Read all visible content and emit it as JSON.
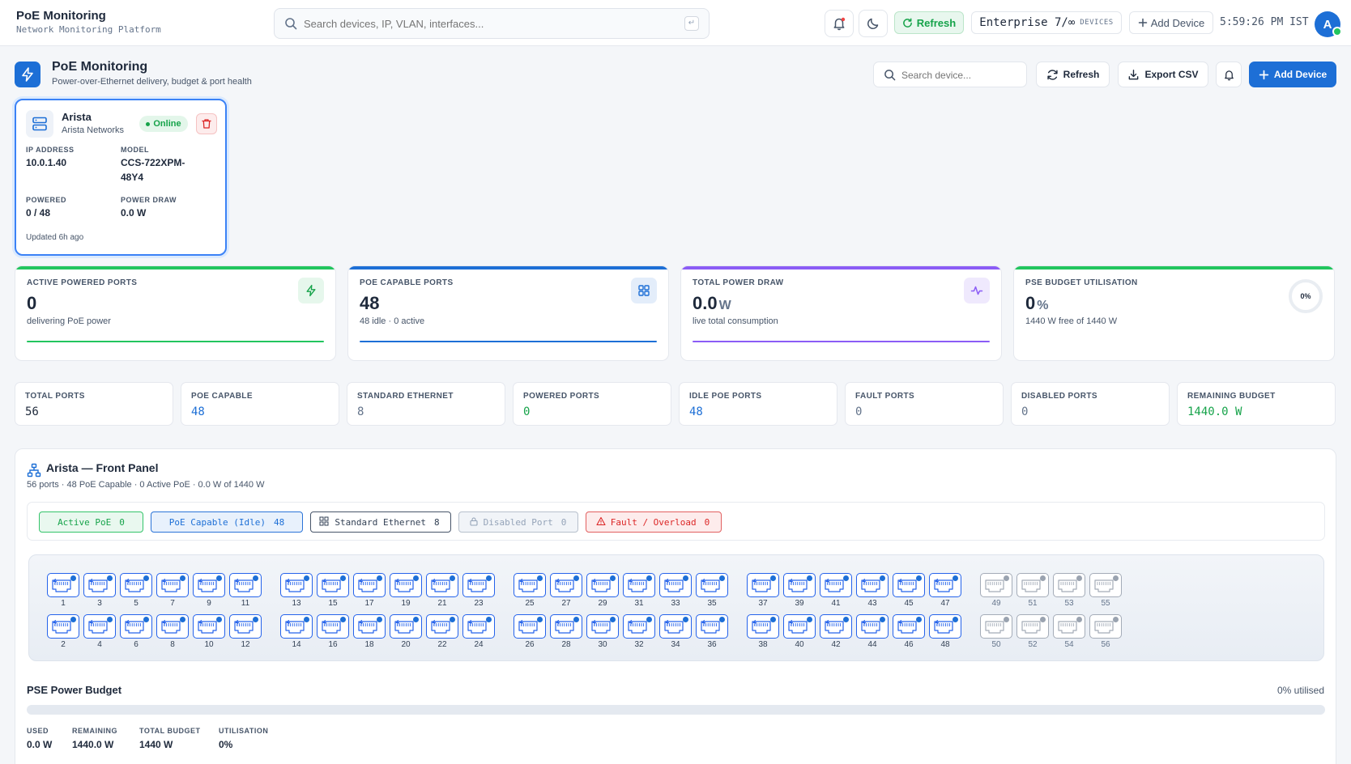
{
  "app": {
    "title": "PoE Monitoring",
    "subtitle": "Network Monitoring Platform"
  },
  "topbar": {
    "search_placeholder": "Search devices, IP, VLAN, interfaces...",
    "search_kbd": "↵",
    "refresh_label": "Refresh",
    "plan_name": "Enterprise 7/∞",
    "plan_suffix": "DEVICES",
    "add_device_label": "Add Device",
    "clock": "5:59:26 PM IST",
    "avatar_initial": "A"
  },
  "header": {
    "title": "PoE Monitoring",
    "subtitle": "Power-over-Ethernet delivery, budget & port health",
    "search_placeholder": "Search device...",
    "refresh_label": "Refresh",
    "export_label": "Export CSV",
    "add_device_label": "Add Device"
  },
  "device": {
    "name": "Arista",
    "vendor": "Arista Networks",
    "status": "Online",
    "ip_label": "IP ADDRESS",
    "ip": "10.0.1.40",
    "model_label": "MODEL",
    "model_line1": "CCS-722XPM-",
    "model_line2": "48Y4",
    "powered_label": "POWERED",
    "powered": "0 / 48",
    "draw_label": "POWER DRAW",
    "draw": "0.0 W",
    "updated": "Updated 6h ago"
  },
  "stats": [
    {
      "label": "ACTIVE POWERED PORTS",
      "value": "0",
      "unit": "",
      "sub": "delivering PoE power",
      "color": "#22c55e",
      "icon": "bolt-icon"
    },
    {
      "label": "POE CAPABLE PORTS",
      "value": "48",
      "unit": "",
      "sub": "48 idle · 0 active",
      "color": "#1d6fd6",
      "icon": "grid-icon"
    },
    {
      "label": "TOTAL POWER DRAW",
      "value": "0.0",
      "unit": "W",
      "sub": "live total consumption",
      "color": "#8b5cf6",
      "icon": "activity-icon"
    },
    {
      "label": "PSE BUDGET UTILISATION",
      "value": "0",
      "unit": "%",
      "sub": "1440 W free of 1440 W",
      "color": "#22c55e",
      "icon": "ring",
      "ring_label": "0%"
    }
  ],
  "tiles": [
    {
      "label": "TOTAL PORTS",
      "value": "56",
      "color": "#1e293b"
    },
    {
      "label": "POE CAPABLE",
      "value": "48",
      "color": "#1d6fd6"
    },
    {
      "label": "STANDARD ETHERNET",
      "value": "8",
      "color": "#64748b"
    },
    {
      "label": "POWERED PORTS",
      "value": "0",
      "color": "#16a34a"
    },
    {
      "label": "IDLE POE PORTS",
      "value": "48",
      "color": "#1d6fd6"
    },
    {
      "label": "FAULT PORTS",
      "value": "0",
      "color": "#64748b"
    },
    {
      "label": "DISABLED PORTS",
      "value": "0",
      "color": "#64748b"
    },
    {
      "label": "REMAINING BUDGET",
      "value": "1440.0 W",
      "color": "#16a34a"
    }
  ],
  "panel": {
    "title": "Arista — Front Panel",
    "subtitle": "56 ports · 48 PoE Capable · 0 Active PoE · 0.0 W of 1440 W"
  },
  "legend": [
    {
      "label": "Active PoE",
      "count": "0",
      "color": "#16a34a",
      "bg": "#e9f8ef",
      "border": "#34c46a"
    },
    {
      "label": "PoE Capable (Idle)",
      "count": "48",
      "color": "#1d6fd6",
      "bg": "#e8f1fc",
      "border": "#2b74d8"
    },
    {
      "label": "Standard Ethernet",
      "count": "8",
      "color": "#334155",
      "bg": "#ffffff",
      "border": "#475569"
    },
    {
      "label": "Disabled Port",
      "count": "0",
      "color": "#94a3b8",
      "bg": "#f1f4f8",
      "border": "#b7c0cc"
    },
    {
      "label": "Fault / Overload",
      "count": "0",
      "color": "#dc2626",
      "bg": "#fdecec",
      "border": "#e26060"
    }
  ],
  "ports": {
    "groups": [
      {
        "first": 1,
        "last": 12,
        "type": "poe"
      },
      {
        "first": 13,
        "last": 24,
        "type": "poe"
      },
      {
        "first": 25,
        "last": 36,
        "type": "poe"
      },
      {
        "first": 37,
        "last": 48,
        "type": "poe"
      },
      {
        "first": 49,
        "last": 56,
        "type": "std"
      }
    ]
  },
  "budget": {
    "title": "PSE Power Budget",
    "util_text": "0% utilised",
    "utilisation_fraction": 0,
    "used_label": "USED",
    "used": "0.0 W",
    "remaining_label": "REMAINING",
    "remaining": "1440.0 W",
    "total_label": "TOTAL BUDGET",
    "total": "1440 W",
    "util_label": "UTILISATION",
    "util": "0%"
  }
}
